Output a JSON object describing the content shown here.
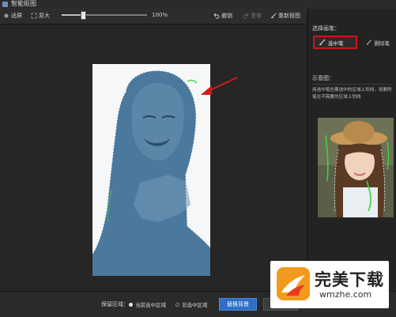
{
  "window": {
    "title": "智能抠图"
  },
  "toolbar": {
    "rotate_label": "适屏",
    "original_label": "原大",
    "zoom_text": "100%",
    "zoom_level": 0.25,
    "undo_label": "撤销",
    "redo_label": "重做",
    "redraw_label": "重新抠图"
  },
  "right_panel": {
    "brush_title": "选择画笔：",
    "select_pen_label": "选中笔",
    "erase_pen_label": "删除笔",
    "example_title": "示意图：",
    "description": "用选中笔在要选中的区域上划线，用删除笔在不需要的区域上划线"
  },
  "bottom_bar": {
    "keep_region_label": "保留区域：",
    "option_current": "当前选中区域",
    "option_unselected": "非选中区域",
    "save_button": "替换背景",
    "cancel_button": "取消"
  },
  "watermark": {
    "name": "完美下载",
    "url": "wmzhe.com"
  },
  "colors": {
    "accent_blue": "#2f6fc6",
    "highlight_red": "#c8191d",
    "selection_tint": "#3c6d95"
  }
}
